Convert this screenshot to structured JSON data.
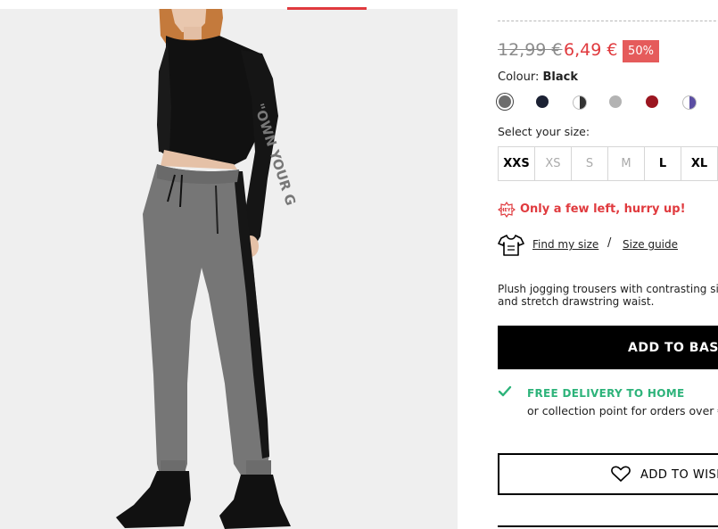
{
  "price": {
    "old": "12,99 €",
    "new": "6,49 €",
    "discount": "50%"
  },
  "colour": {
    "label": "Colour:",
    "selected": "Black",
    "swatches": [
      {
        "name": "dark-grey",
        "color": "#6d6d6d"
      },
      {
        "name": "navy",
        "color": "#1b2133"
      },
      {
        "name": "black-white",
        "color": "#444444"
      },
      {
        "name": "light-grey",
        "color": "#b3b3b3"
      },
      {
        "name": "burgundy",
        "color": "#9b1620"
      },
      {
        "name": "purple-white",
        "color": "#5b4ea3"
      }
    ]
  },
  "size": {
    "label": "Select your size:",
    "options": [
      {
        "label": "XXS",
        "available": true
      },
      {
        "label": "XS",
        "available": false
      },
      {
        "label": "S",
        "available": false
      },
      {
        "label": "M",
        "available": false
      },
      {
        "label": "L",
        "available": true
      },
      {
        "label": "XL",
        "available": true
      }
    ]
  },
  "stock": {
    "badge_text": "HEY!",
    "message": "Only a few left, hurry up!"
  },
  "fit": {
    "find_size": "Find my size",
    "separator": "/",
    "size_guide": "Size guide"
  },
  "description": {
    "line1": "Plush jogging trousers with contrasting side",
    "line2": "and stretch drawstring waist."
  },
  "actions": {
    "add_to_basket": "ADD TO BASKET",
    "add_to_wishlist": "ADD TO WISHLIST"
  },
  "delivery": {
    "title": "FREE DELIVERY TO HOME",
    "subtitle": "or collection point for orders over €"
  },
  "product_image": {
    "sleeve_text": "\"OWN YOUR G"
  }
}
